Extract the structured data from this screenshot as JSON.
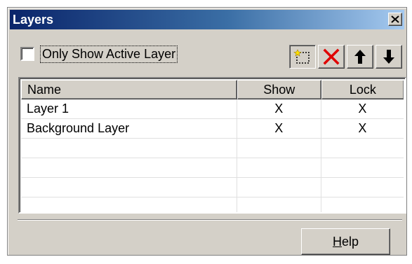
{
  "window": {
    "title": "Layers"
  },
  "options": {
    "only_show_active_label": "Only Show Active Layer",
    "only_show_active_checked": false
  },
  "toolbar": {
    "buttons": [
      {
        "icon": "new-layer-icon"
      },
      {
        "icon": "delete-x-icon",
        "color": "#e00000"
      },
      {
        "icon": "arrow-up-icon"
      },
      {
        "icon": "arrow-down-icon"
      }
    ]
  },
  "table": {
    "columns": [
      "Name",
      "Show",
      "Lock"
    ],
    "rows": [
      {
        "name": "Layer 1",
        "show": "X",
        "lock": "X"
      },
      {
        "name": "Background Layer",
        "show": "X",
        "lock": "X"
      }
    ]
  },
  "footer": {
    "help_accel": "H",
    "help_rest": "elp"
  },
  "colors": {
    "titlebar_start": "#0a246a",
    "titlebar_end": "#a6caf0",
    "face": "#d4d0c8"
  }
}
